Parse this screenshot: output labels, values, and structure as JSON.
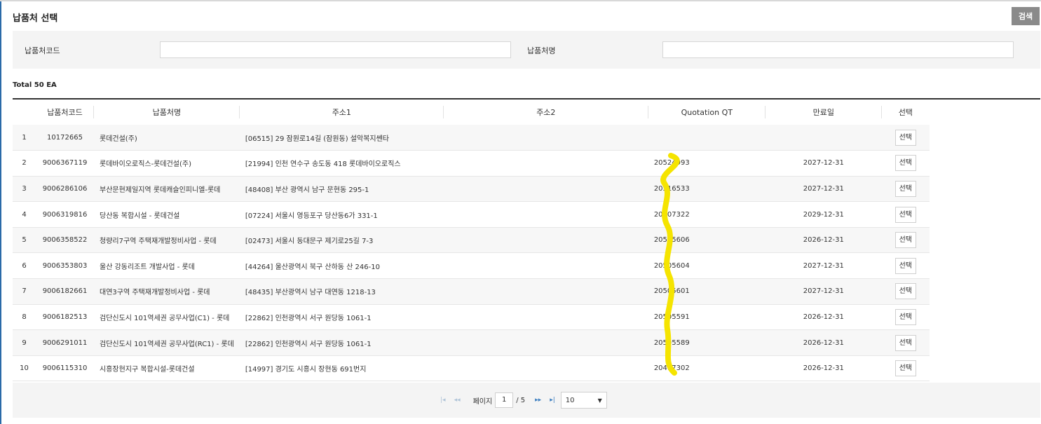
{
  "header": {
    "title": "납품처 선택",
    "search_label": "검색"
  },
  "filter": {
    "code_label": "납품처코드",
    "code_value": "",
    "name_label": "납품처명",
    "name_value": ""
  },
  "summary": {
    "total": "Total 50 EA"
  },
  "table": {
    "columns": [
      "",
      "납품처코드",
      "납품처명",
      "주소1",
      "주소2",
      "Quotation QT",
      "만료일",
      "선택"
    ],
    "rows": [
      {
        "no": "1",
        "code": "10172665",
        "name": "롯데건설(주)",
        "addr1": "[06515] 29 잠원로14길 (잠원동) 설악복지쎈타",
        "addr2": "",
        "qt": "",
        "expiry": "",
        "select": "선택"
      },
      {
        "no": "2",
        "code": "9006367119",
        "name": "롯데바이오로직스-롯데건설(주)",
        "addr1": "[21994] 인천 연수구 송도동 418 롯데바이오로직스",
        "addr2": "",
        "qt": "20524993",
        "expiry": "2027-12-31",
        "select": "선택"
      },
      {
        "no": "3",
        "code": "9006286106",
        "name": "부산문현제일지역 롯데캐슬인피니엘-롯데",
        "addr1": "[48408] 부산 광역시 남구 문현동 295-1",
        "addr2": "",
        "qt": "20516533",
        "expiry": "2027-12-31",
        "select": "선택"
      },
      {
        "no": "4",
        "code": "9006319816",
        "name": "당산동 복합시설 - 롯데건설",
        "addr1": "[07224] 서울시 영등포구 당산동6가 331-1",
        "addr2": "",
        "qt": "20507322",
        "expiry": "2029-12-31",
        "select": "선택"
      },
      {
        "no": "5",
        "code": "9006358522",
        "name": "청량리7구역 주택재개발정비사업 - 롯데",
        "addr1": "[02473] 서울시 동대문구 제기로25길 7-3",
        "addr2": "",
        "qt": "20505606",
        "expiry": "2026-12-31",
        "select": "선택"
      },
      {
        "no": "6",
        "code": "9006353803",
        "name": "울산 강동리조트 개발사업 - 롯데",
        "addr1": "[44264] 울산광역시 북구 산하동 산 246-10",
        "addr2": "",
        "qt": "20505604",
        "expiry": "2027-12-31",
        "select": "선택"
      },
      {
        "no": "7",
        "code": "9006182661",
        "name": "대연3구역 주택재개발정비사업 - 롯데",
        "addr1": "[48435] 부산광역시 남구 대연동 1218-13",
        "addr2": "",
        "qt": "20505601",
        "expiry": "2027-12-31",
        "select": "선택"
      },
      {
        "no": "8",
        "code": "9006182513",
        "name": "검단신도시 101역세권 공무사업(C1) - 롯데",
        "addr1": "[22862] 인천광역시 서구 원당동 1061-1",
        "addr2": "",
        "qt": "20505591",
        "expiry": "2026-12-31",
        "select": "선택"
      },
      {
        "no": "9",
        "code": "9006291011",
        "name": "검단신도시 101역세권 공무사업(RC1) - 롯데",
        "addr1": "[22862] 인천광역시 서구 원당동 1061-1",
        "addr2": "",
        "qt": "20505589",
        "expiry": "2026-12-31",
        "select": "선택"
      },
      {
        "no": "10",
        "code": "9006115310",
        "name": "시흥장현지구 복합시설-롯데건설",
        "addr1": "[14997] 경기도 시흥시 장현동 691번지",
        "addr2": "",
        "qt": "20497302",
        "expiry": "2026-12-31",
        "select": "선택"
      }
    ]
  },
  "pagination": {
    "first_icon": "first-page-icon",
    "prev_icon": "prev-page-icon",
    "next_icon": "next-page-icon",
    "last_icon": "last-page-icon",
    "page_label": "페이지",
    "current_page": "1",
    "total_pages": "/ 5",
    "page_size": "10"
  },
  "annotation": {
    "color": "#f5e400"
  }
}
